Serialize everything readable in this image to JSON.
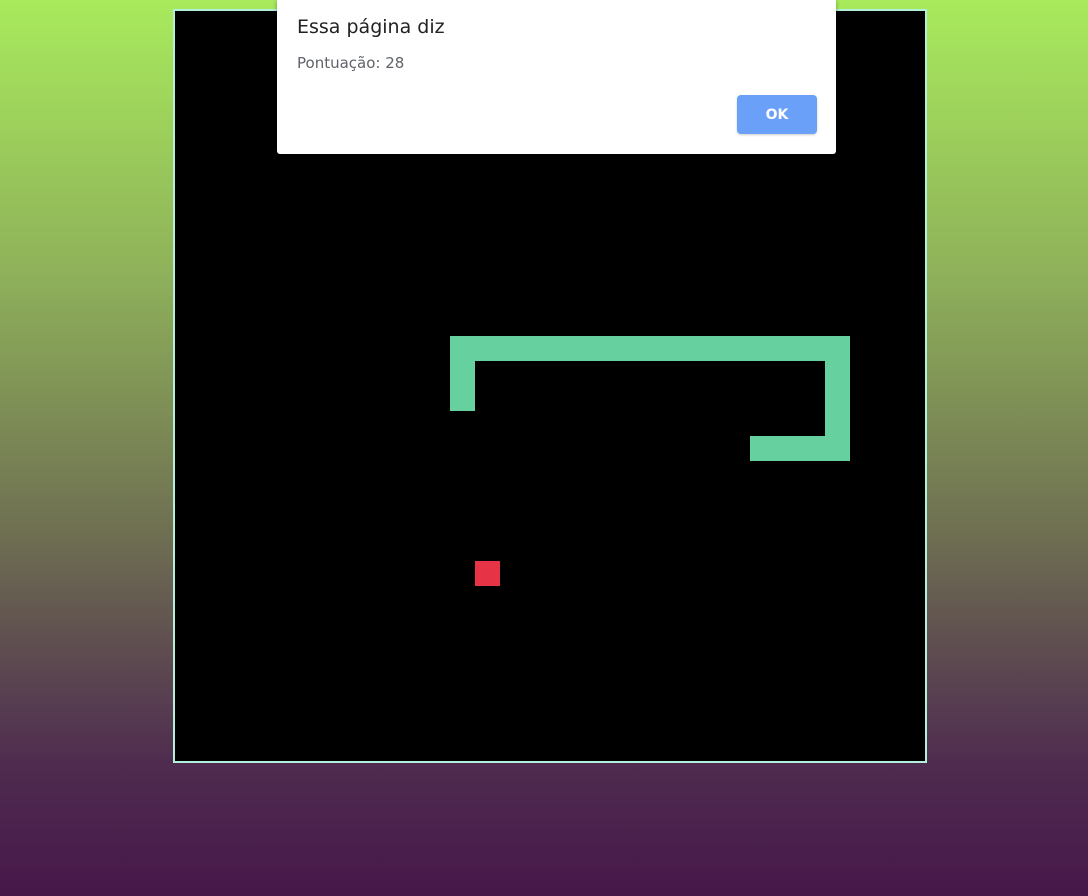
{
  "dialog": {
    "title": "Essa página diz",
    "message": "Pontuação: 28",
    "ok_label": "OK"
  },
  "game": {
    "board_color": "#000000",
    "border_color": "#b2f0dc",
    "snake_color": "#66d19e",
    "food_color": "#e63446"
  }
}
